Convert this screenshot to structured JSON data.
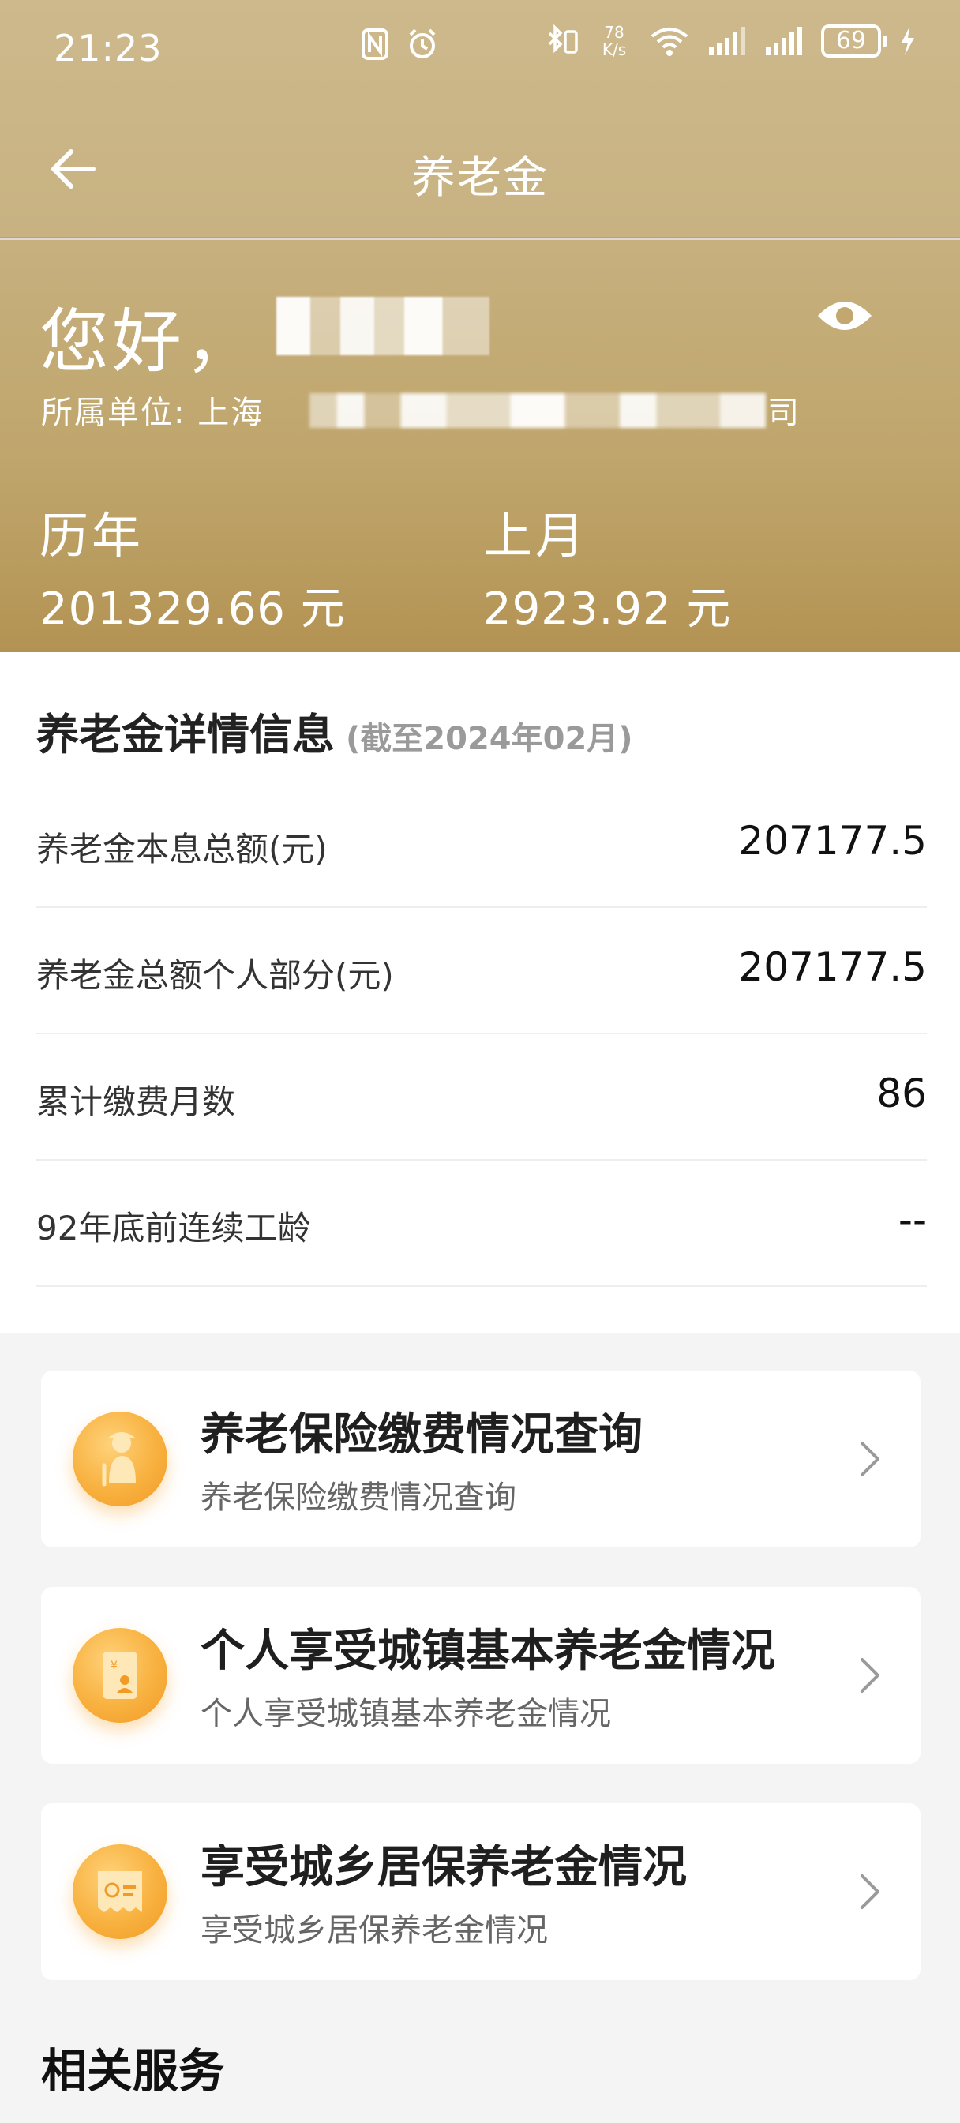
{
  "status_bar": {
    "time": "21:23",
    "net_speed_top": "78",
    "net_speed_unit": "K/s",
    "battery": "69"
  },
  "nav": {
    "title": "养老金"
  },
  "summary": {
    "greeting": "您好，",
    "unit_label": "所属单位: 上海",
    "unit_tail": "司",
    "history_label": "历年",
    "history_value": "201329.66 元",
    "last_month_label": "上月",
    "last_month_value": "2923.92 元"
  },
  "details": {
    "title": "养老金详情信息",
    "subtitle": "(截至2024年02月)",
    "rows": [
      {
        "label": "养老金本息总额(元)",
        "value": "207177.5"
      },
      {
        "label": "养老金总额个人部分(元)",
        "value": "207177.5"
      },
      {
        "label": "累计缴费月数",
        "value": "86"
      },
      {
        "label": "92年底前连续工龄",
        "value": "--"
      }
    ]
  },
  "services": [
    {
      "title": "养老保险缴费情况查询",
      "subtitle": "养老保险缴费情况查询",
      "icon": "elderly-person-icon"
    },
    {
      "title": "个人享受城镇基本养老金情况",
      "subtitle": "个人享受城镇基本养老金情况",
      "icon": "document-icon"
    },
    {
      "title": "享受城乡居保养老金情况",
      "subtitle": "享受城乡居保养老金情况",
      "icon": "receipt-icon"
    }
  ],
  "related": {
    "title": "相关服务"
  },
  "colors": {
    "header_gold": "#c8b282",
    "accent_orange": "#f8b13f"
  }
}
